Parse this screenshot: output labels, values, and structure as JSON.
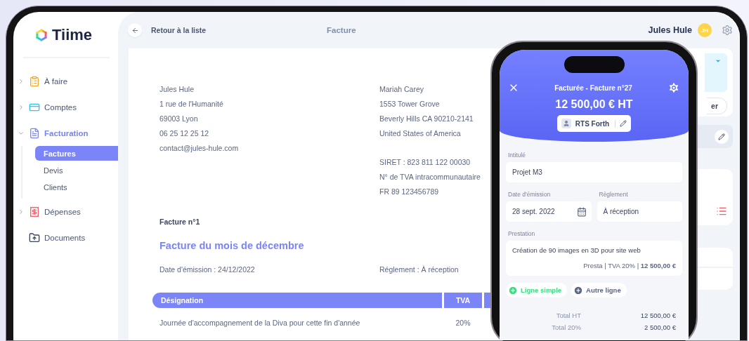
{
  "app": {
    "logo": "Tiime"
  },
  "sidebar": {
    "items": [
      {
        "label": "À faire",
        "kind": "todo",
        "expanded": false,
        "selected": false
      },
      {
        "label": "Comptes",
        "kind": "accounts",
        "expanded": false,
        "selected": false
      },
      {
        "label": "Facturation",
        "kind": "billing",
        "expanded": true,
        "selected": true,
        "children": [
          {
            "label": "Factures",
            "selected": true
          },
          {
            "label": "Devis",
            "selected": false
          },
          {
            "label": "Clients",
            "selected": false
          }
        ]
      },
      {
        "label": "Dépenses",
        "kind": "expenses",
        "expanded": false,
        "selected": false
      },
      {
        "label": "Documents",
        "kind": "documents",
        "selected": false
      }
    ]
  },
  "header": {
    "back_label": "Retour à la liste",
    "title": "Facture",
    "user_name": "Jules Hule",
    "avatar_initials": "JH"
  },
  "invoice": {
    "sender": [
      "Jules Hule",
      "1 rue de l'Humanité",
      "69003 Lyon",
      "06 25 12 25 12",
      "contact@jules-hule.com"
    ],
    "recipient": [
      "Mariah Carey",
      "1553 Tower Grove",
      "Beverly Hills CA 90210-2141",
      "United States of America"
    ],
    "recipient_ids": [
      "SIRET : 823 811 122 00030",
      "N° de TVA intracommunautaire",
      "FR 89 123456789"
    ],
    "number": "Facture n°1",
    "subject": "Facture du mois de décembre",
    "issue_date": "Date d'émission : 24/12/2022",
    "payment": "Réglement : À réception",
    "table": {
      "columns": [
        "Désignation",
        "TVA"
      ],
      "rows": [
        [
          "Journée d'accompagnement de la Diva pour cette fin d'année",
          "20%"
        ]
      ]
    }
  },
  "side_panel": {
    "button_label": "er"
  },
  "phone": {
    "title": "Facturée - Facture n°27",
    "amount": "12 500,00 € HT",
    "client": "RTS Forth",
    "title_field": {
      "label": "Intitulé",
      "value": "Projet M3"
    },
    "date_field": {
      "label": "Date d'émission",
      "value": "28 sept. 2022"
    },
    "payment_field": {
      "label": "Règlement",
      "value": "À réception"
    },
    "service": {
      "label": "Prestation",
      "description": "Création de 90 images en 3D pour site web",
      "details": "Presta | TVA 20% | **12 500,00 €**"
    },
    "add_buttons": [
      {
        "label": "Ligne simple",
        "kind": "simple"
      },
      {
        "label": "Autre ligne",
        "kind": "other"
      }
    ],
    "totals": [
      {
        "label": "Total HT",
        "value": "12 500,00 €"
      },
      {
        "label": "Total 20%",
        "value": "2 500,00 €"
      }
    ]
  }
}
